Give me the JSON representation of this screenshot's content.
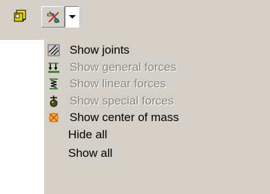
{
  "toolbar": {
    "buttons": [
      {
        "icon": "body-folder-icon"
      },
      {
        "icon": "display-options-icon"
      },
      {
        "icon": "chevron-down-icon"
      }
    ]
  },
  "menu": {
    "items": [
      {
        "label": "Show joints",
        "icon": "joints-icon",
        "enabled": true
      },
      {
        "label": "Show general forces",
        "icon": "general-forces-icon",
        "enabled": false
      },
      {
        "label": "Show linear forces",
        "icon": "linear-forces-icon",
        "enabled": false
      },
      {
        "label": "Show special forces",
        "icon": "special-forces-icon",
        "enabled": false
      },
      {
        "label": "Show center of mass",
        "icon": "center-of-mass-icon",
        "enabled": true
      },
      {
        "label": "Hide all",
        "icon": "",
        "enabled": true
      },
      {
        "label": "Show all",
        "icon": "",
        "enabled": true
      }
    ]
  },
  "colors": {
    "face": "#d4d0c8",
    "disabled_text": "#8a877f",
    "accent_yellow": "#f0e020",
    "accent_green": "#3a8a2a"
  }
}
